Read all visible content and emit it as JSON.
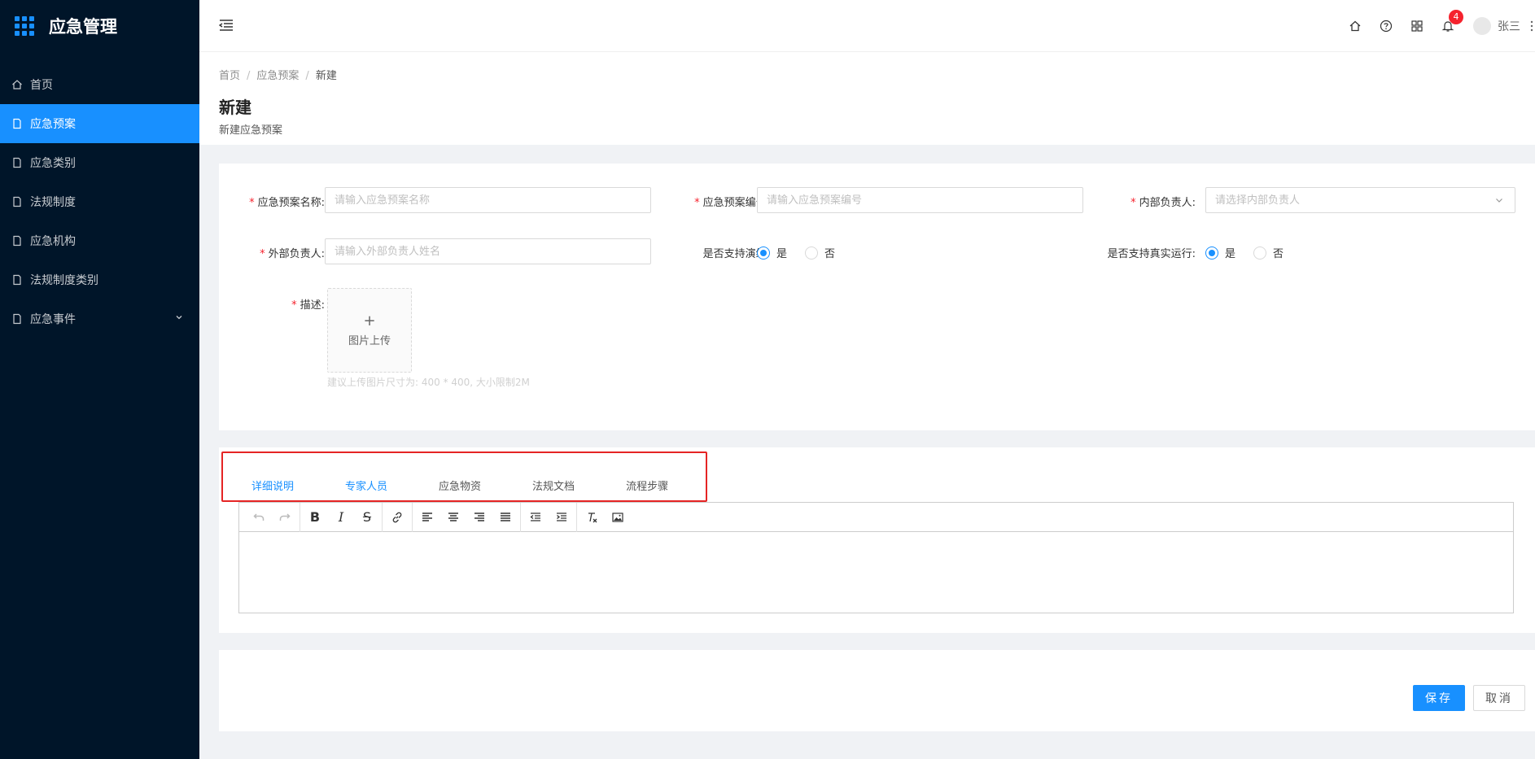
{
  "app": {
    "title": "应急管理"
  },
  "sidebar": {
    "items": [
      {
        "label": "首页",
        "icon": "home-icon",
        "active": false
      },
      {
        "label": "应急预案",
        "icon": "file-icon",
        "active": true
      },
      {
        "label": "应急类别",
        "icon": "file-icon",
        "active": false
      },
      {
        "label": "法规制度",
        "icon": "file-icon",
        "active": false
      },
      {
        "label": "应急机构",
        "icon": "file-icon",
        "active": false
      },
      {
        "label": "法规制度类别",
        "icon": "file-icon",
        "active": false
      },
      {
        "label": "应急事件",
        "icon": "file-icon",
        "active": false,
        "has_submenu": true
      }
    ]
  },
  "header": {
    "notification_count": "4",
    "username": "张三"
  },
  "breadcrumb": [
    "首页",
    "应急预案",
    "新建"
  ],
  "page": {
    "title": "新建",
    "subtitle": "新建应急预案"
  },
  "form": {
    "name": {
      "label": "应急预案名称:",
      "placeholder": "请输入应急预案名称"
    },
    "code": {
      "label": "应急预案编号:",
      "placeholder": "请输入应急预案编号"
    },
    "internal_owner": {
      "label": "内部负责人:",
      "placeholder": "请选择内部负责人"
    },
    "external_owner": {
      "label": "外部负责人:",
      "placeholder": "请输入外部负责人姓名"
    },
    "support_drill": {
      "label": "是否支持演练:",
      "options": [
        "是",
        "否"
      ],
      "selected": "是"
    },
    "support_real": {
      "label": "是否支持真实运行:",
      "options": [
        "是",
        "否"
      ],
      "selected": "是"
    },
    "description": {
      "label": "描述:",
      "upload_plus": "+",
      "upload_text": "图片上传",
      "hint": "建议上传图片尺寸为: 400 * 400, 大小限制2M"
    }
  },
  "tabs": [
    "详细说明",
    "专家人员",
    "应急物资",
    "法规文档",
    "流程步骤"
  ],
  "actions": {
    "save": "保存",
    "cancel": "取消"
  },
  "colors": {
    "sidebar_bg": "#001529",
    "accent": "#1890ff",
    "required": "#f5222d",
    "highlight_border": "#e52424"
  }
}
